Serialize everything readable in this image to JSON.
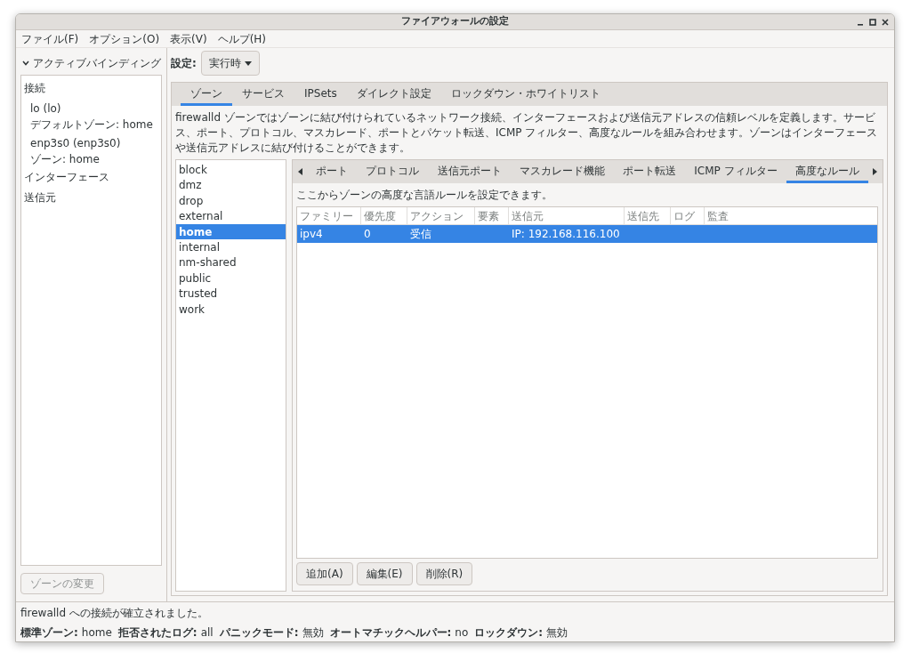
{
  "window": {
    "title": "ファイアウォールの設定"
  },
  "menu": [
    "ファイル(F)",
    "オプション(O)",
    "表示(V)",
    "ヘルプ(H)"
  ],
  "sidebar": {
    "header": {
      "label": "アクティブバインディング",
      "expanded": true
    },
    "sections": [
      {
        "label": "接続",
        "items": [
          {
            "name": "lo (lo)",
            "detail": "デフォルトゾーン: home"
          },
          {
            "name": "enp3s0 (enp3s0)",
            "detail": "ゾーン: home"
          }
        ]
      },
      {
        "label": "インターフェース"
      },
      {
        "label": "送信元"
      }
    ],
    "button": {
      "label": "ゾーンの変更",
      "disabled": true
    }
  },
  "config": {
    "label": "設定:",
    "value": "実行時"
  },
  "tabs": [
    {
      "label": "ゾーン",
      "selected": true
    },
    {
      "label": "サービス",
      "selected": false
    },
    {
      "label": "IPSets",
      "selected": false
    },
    {
      "label": "ダイレクト設定",
      "selected": false
    },
    {
      "label": "ロックダウン・ホワイトリスト",
      "selected": false
    }
  ],
  "description": "firewalld ゾーンではゾーンに結び付けられているネットワーク接続、インターフェースおよび送信元アドレスの信頼レベルを定義します。サービス、ポート、プロトコル、マスカレード、ポートとパケット転送、ICMP フィルター、高度なルールを組み合わせます。ゾーンはインターフェースや送信元アドレスに結び付けることができます。",
  "zones": [
    {
      "label": "block",
      "selected": false
    },
    {
      "label": "dmz",
      "selected": false
    },
    {
      "label": "drop",
      "selected": false
    },
    {
      "label": "external",
      "selected": false
    },
    {
      "label": "home",
      "selected": true
    },
    {
      "label": "internal",
      "selected": false
    },
    {
      "label": "nm-shared",
      "selected": false
    },
    {
      "label": "public",
      "selected": false
    },
    {
      "label": "trusted",
      "selected": false
    },
    {
      "label": "work",
      "selected": false
    }
  ],
  "zone_tabs": [
    {
      "label": "ポート",
      "selected": false
    },
    {
      "label": "プロトコル",
      "selected": false
    },
    {
      "label": "送信元ポート",
      "selected": false
    },
    {
      "label": "マスカレード機能",
      "selected": false
    },
    {
      "label": "ポート転送",
      "selected": false
    },
    {
      "label": "ICMP フィルター",
      "selected": false
    },
    {
      "label": "高度なルール",
      "selected": true
    }
  ],
  "rules": {
    "hint": "ここからゾーンの高度な言語ルールを設定できます。",
    "table": {
      "columns": [
        "ファミリー",
        "優先度",
        "アクション",
        "要素",
        "送信元",
        "送信先",
        "ログ",
        "監査"
      ],
      "rows": [
        {
          "cells": [
            "ipv4",
            "0",
            "受信",
            "",
            "IP: 192.168.116.100",
            "",
            "",
            ""
          ],
          "selected": true
        }
      ]
    },
    "buttons": [
      "追加(A)",
      "編集(E)",
      "削除(R)"
    ]
  },
  "status_bar": {
    "message": "firewalld への接続が確立されました。",
    "items": [
      {
        "label": "標準ゾーン:",
        "value": "home"
      },
      {
        "label": "拒否されたログ:",
        "value": "all"
      },
      {
        "label": "パニックモード:",
        "value": "無効"
      },
      {
        "label": "オートマチックヘルパー:",
        "value": "no"
      },
      {
        "label": "ロックダウン:",
        "value": "無効"
      }
    ]
  }
}
